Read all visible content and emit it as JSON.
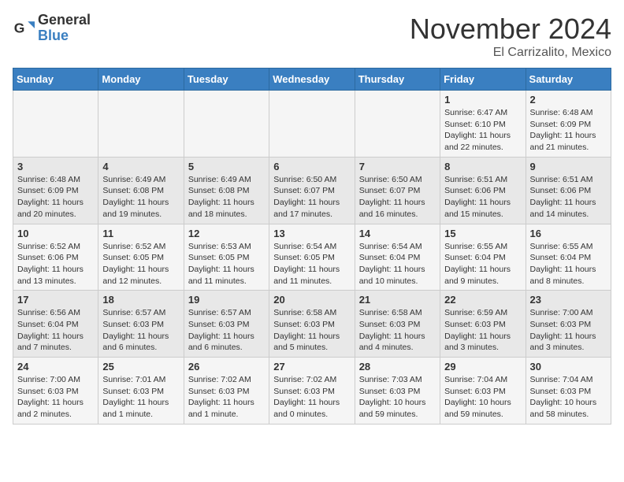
{
  "header": {
    "logo_general": "General",
    "logo_blue": "Blue",
    "month": "November 2024",
    "location": "El Carrizalito, Mexico"
  },
  "weekdays": [
    "Sunday",
    "Monday",
    "Tuesday",
    "Wednesday",
    "Thursday",
    "Friday",
    "Saturday"
  ],
  "weeks": [
    [
      {
        "day": "",
        "info": ""
      },
      {
        "day": "",
        "info": ""
      },
      {
        "day": "",
        "info": ""
      },
      {
        "day": "",
        "info": ""
      },
      {
        "day": "",
        "info": ""
      },
      {
        "day": "1",
        "info": "Sunrise: 6:47 AM\nSunset: 6:10 PM\nDaylight: 11 hours\nand 22 minutes."
      },
      {
        "day": "2",
        "info": "Sunrise: 6:48 AM\nSunset: 6:09 PM\nDaylight: 11 hours\nand 21 minutes."
      }
    ],
    [
      {
        "day": "3",
        "info": "Sunrise: 6:48 AM\nSunset: 6:09 PM\nDaylight: 11 hours\nand 20 minutes."
      },
      {
        "day": "4",
        "info": "Sunrise: 6:49 AM\nSunset: 6:08 PM\nDaylight: 11 hours\nand 19 minutes."
      },
      {
        "day": "5",
        "info": "Sunrise: 6:49 AM\nSunset: 6:08 PM\nDaylight: 11 hours\nand 18 minutes."
      },
      {
        "day": "6",
        "info": "Sunrise: 6:50 AM\nSunset: 6:07 PM\nDaylight: 11 hours\nand 17 minutes."
      },
      {
        "day": "7",
        "info": "Sunrise: 6:50 AM\nSunset: 6:07 PM\nDaylight: 11 hours\nand 16 minutes."
      },
      {
        "day": "8",
        "info": "Sunrise: 6:51 AM\nSunset: 6:06 PM\nDaylight: 11 hours\nand 15 minutes."
      },
      {
        "day": "9",
        "info": "Sunrise: 6:51 AM\nSunset: 6:06 PM\nDaylight: 11 hours\nand 14 minutes."
      }
    ],
    [
      {
        "day": "10",
        "info": "Sunrise: 6:52 AM\nSunset: 6:06 PM\nDaylight: 11 hours\nand 13 minutes."
      },
      {
        "day": "11",
        "info": "Sunrise: 6:52 AM\nSunset: 6:05 PM\nDaylight: 11 hours\nand 12 minutes."
      },
      {
        "day": "12",
        "info": "Sunrise: 6:53 AM\nSunset: 6:05 PM\nDaylight: 11 hours\nand 11 minutes."
      },
      {
        "day": "13",
        "info": "Sunrise: 6:54 AM\nSunset: 6:05 PM\nDaylight: 11 hours\nand 11 minutes."
      },
      {
        "day": "14",
        "info": "Sunrise: 6:54 AM\nSunset: 6:04 PM\nDaylight: 11 hours\nand 10 minutes."
      },
      {
        "day": "15",
        "info": "Sunrise: 6:55 AM\nSunset: 6:04 PM\nDaylight: 11 hours\nand 9 minutes."
      },
      {
        "day": "16",
        "info": "Sunrise: 6:55 AM\nSunset: 6:04 PM\nDaylight: 11 hours\nand 8 minutes."
      }
    ],
    [
      {
        "day": "17",
        "info": "Sunrise: 6:56 AM\nSunset: 6:04 PM\nDaylight: 11 hours\nand 7 minutes."
      },
      {
        "day": "18",
        "info": "Sunrise: 6:57 AM\nSunset: 6:03 PM\nDaylight: 11 hours\nand 6 minutes."
      },
      {
        "day": "19",
        "info": "Sunrise: 6:57 AM\nSunset: 6:03 PM\nDaylight: 11 hours\nand 6 minutes."
      },
      {
        "day": "20",
        "info": "Sunrise: 6:58 AM\nSunset: 6:03 PM\nDaylight: 11 hours\nand 5 minutes."
      },
      {
        "day": "21",
        "info": "Sunrise: 6:58 AM\nSunset: 6:03 PM\nDaylight: 11 hours\nand 4 minutes."
      },
      {
        "day": "22",
        "info": "Sunrise: 6:59 AM\nSunset: 6:03 PM\nDaylight: 11 hours\nand 3 minutes."
      },
      {
        "day": "23",
        "info": "Sunrise: 7:00 AM\nSunset: 6:03 PM\nDaylight: 11 hours\nand 3 minutes."
      }
    ],
    [
      {
        "day": "24",
        "info": "Sunrise: 7:00 AM\nSunset: 6:03 PM\nDaylight: 11 hours\nand 2 minutes."
      },
      {
        "day": "25",
        "info": "Sunrise: 7:01 AM\nSunset: 6:03 PM\nDaylight: 11 hours\nand 1 minute."
      },
      {
        "day": "26",
        "info": "Sunrise: 7:02 AM\nSunset: 6:03 PM\nDaylight: 11 hours\nand 1 minute."
      },
      {
        "day": "27",
        "info": "Sunrise: 7:02 AM\nSunset: 6:03 PM\nDaylight: 11 hours\nand 0 minutes."
      },
      {
        "day": "28",
        "info": "Sunrise: 7:03 AM\nSunset: 6:03 PM\nDaylight: 10 hours\nand 59 minutes."
      },
      {
        "day": "29",
        "info": "Sunrise: 7:04 AM\nSunset: 6:03 PM\nDaylight: 10 hours\nand 59 minutes."
      },
      {
        "day": "30",
        "info": "Sunrise: 7:04 AM\nSunset: 6:03 PM\nDaylight: 10 hours\nand 58 minutes."
      }
    ]
  ]
}
